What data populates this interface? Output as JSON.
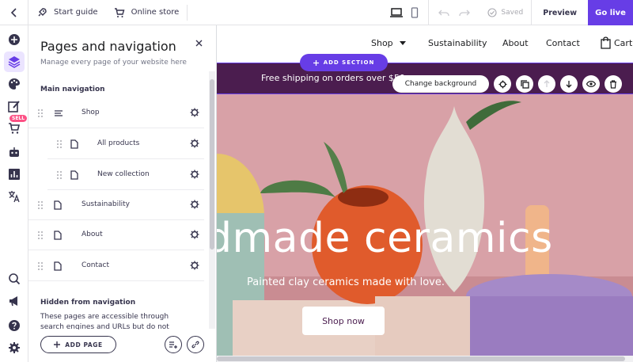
{
  "topbar": {
    "start_guide": "Start guide",
    "online_store": "Online store",
    "saved": "Saved",
    "preview": "Preview",
    "go_live": "Go live"
  },
  "panel": {
    "title": "Pages and navigation",
    "subtitle": "Manage every page of your website here",
    "main_nav_title": "Main navigation",
    "items": [
      {
        "label": "Shop",
        "icon": "lines-icon"
      },
      {
        "label": "All products",
        "icon": "page-icon"
      },
      {
        "label": "New collection",
        "icon": "page-icon"
      },
      {
        "label": "Sustainability",
        "icon": "page-icon"
      },
      {
        "label": "About",
        "icon": "page-icon"
      },
      {
        "label": "Contact",
        "icon": "page-icon"
      }
    ],
    "hidden_title": "Hidden from navigation",
    "hidden_text": "These pages are accessible through search engines and URLs but do not appear in your",
    "add_page": "ADD PAGE"
  },
  "rail": {
    "sell_badge": "SELL"
  },
  "site": {
    "nav": [
      "Shop",
      "Sustainability",
      "About",
      "Contact",
      "Cart"
    ],
    "add_section": "ADD SECTION",
    "banner": "Free shipping on orders over $50",
    "change_background": "Change background",
    "hero_title": "dmade ceramics",
    "hero_subtitle": "Painted clay ceramics made with love.",
    "hero_button": "Shop now"
  },
  "colors": {
    "accent": "#673de6",
    "banner": "#4b1d4f",
    "hero_bg": "#d4949c"
  }
}
